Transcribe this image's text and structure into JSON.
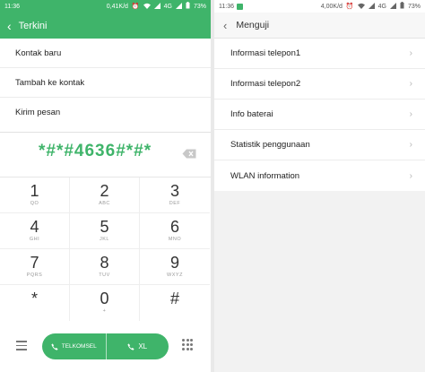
{
  "left": {
    "status": {
      "time": "11:36",
      "speed": "0,41K/d",
      "network": "4G",
      "battery": "73%"
    },
    "header": {
      "title": "Terkini"
    },
    "menu": [
      {
        "label": "Kontak baru"
      },
      {
        "label": "Tambah ke kontak"
      },
      {
        "label": "Kirim pesan"
      }
    ],
    "dialed_number": "*#*#4636#*#*",
    "keypad": [
      {
        "digit": "1",
        "letters": "QO"
      },
      {
        "digit": "2",
        "letters": "ABC"
      },
      {
        "digit": "3",
        "letters": "DEF"
      },
      {
        "digit": "4",
        "letters": "GHI"
      },
      {
        "digit": "5",
        "letters": "JKL"
      },
      {
        "digit": "6",
        "letters": "MNO"
      },
      {
        "digit": "7",
        "letters": "PQRS"
      },
      {
        "digit": "8",
        "letters": "TUV"
      },
      {
        "digit": "9",
        "letters": "WXYZ"
      },
      {
        "digit": "*",
        "letters": ""
      },
      {
        "digit": "0",
        "letters": "+"
      },
      {
        "digit": "#",
        "letters": ""
      }
    ],
    "call": {
      "sim1_label": "TELKOMSEL",
      "sim2_label": "XL"
    }
  },
  "right": {
    "status": {
      "time": "11:36",
      "speed": "4,00K/d",
      "network": "4G",
      "battery": "73%"
    },
    "header": {
      "title": "Menguji"
    },
    "menu": [
      {
        "label": "Informasi telepon1"
      },
      {
        "label": "Informasi telepon2"
      },
      {
        "label": "Info baterai"
      },
      {
        "label": "Statistik penggunaan"
      },
      {
        "label": "WLAN information"
      }
    ]
  },
  "colors": {
    "accent": "#3fb46a",
    "text": "#222222",
    "muted": "#9a9a9a"
  },
  "icons": {
    "back": "arrow-left-icon",
    "backspace": "backspace-icon",
    "menu": "hamburger-icon",
    "dialpad": "dialpad-icon",
    "call": "phone-icon",
    "chevron": "chevron-right-icon"
  }
}
